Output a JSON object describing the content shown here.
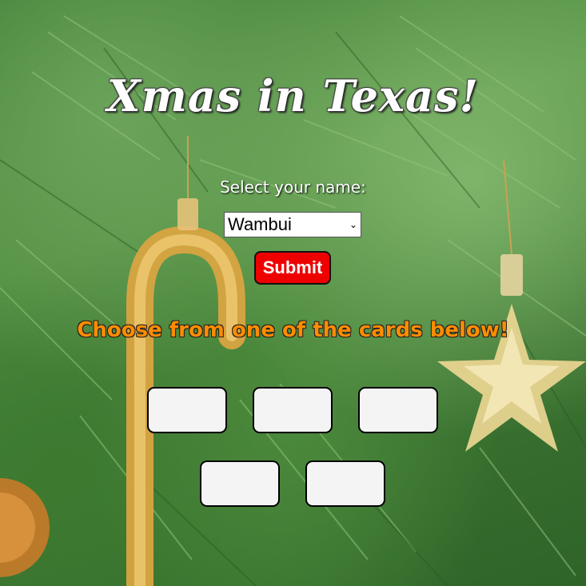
{
  "header": {
    "title": "Xmas in Texas!"
  },
  "form": {
    "select_label": "Select your name:",
    "selected_name": "Wambui",
    "submit_label": "Submit"
  },
  "cards_section": {
    "heading": "Choose from one of the cards below!",
    "card_count": 5
  },
  "colors": {
    "submit_bg": "#ee0000",
    "heading": "#ff8c00",
    "card_bg": "#f4f4f4"
  },
  "background": {
    "description_icons": [
      "pine-branches",
      "candy-cane-ornament",
      "star-ornament",
      "ball-ornament"
    ]
  }
}
